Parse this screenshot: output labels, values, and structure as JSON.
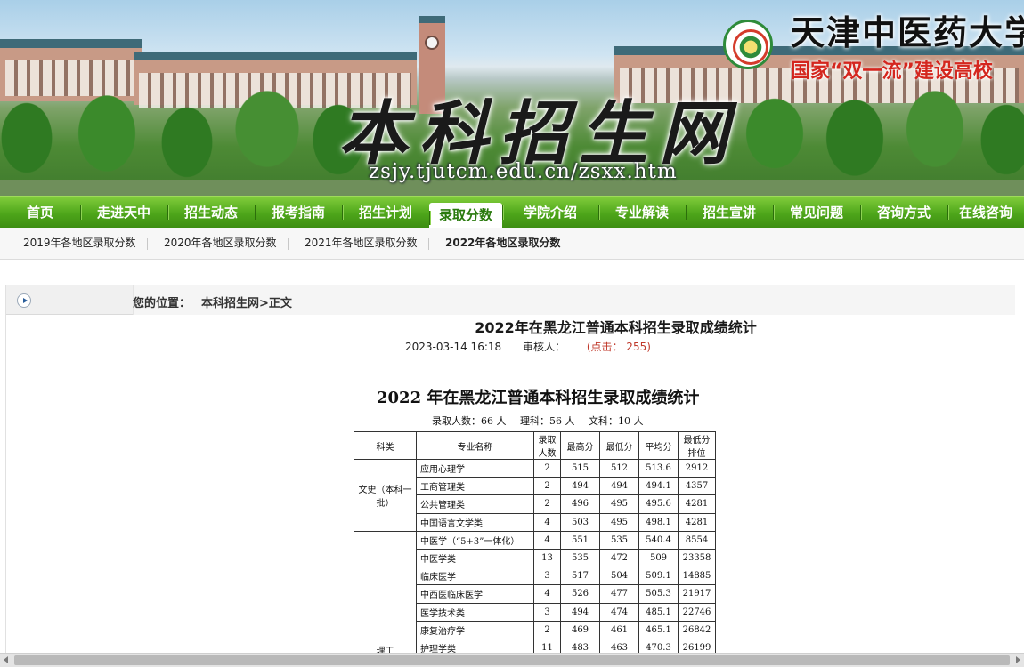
{
  "banner": {
    "title": "本科招生网",
    "url": "zsjy.tjutcm.edu.cn/zsxx.htm",
    "university": "天津中医药大学",
    "slogan": "国家“双一流”建设高校"
  },
  "nav": {
    "items": [
      "首页",
      "走进天中",
      "招生动态",
      "报考指南",
      "招生计划",
      "录取分数",
      "学院介绍",
      "专业解读",
      "招生宣讲",
      "常见问题",
      "咨询方式",
      "在线咨询"
    ],
    "active_index": 5
  },
  "subnav": {
    "items": [
      "2019年各地区录取分数",
      "2020年各地区录取分数",
      "2021年各地区录取分数",
      "2022年各地区录取分数"
    ],
    "active_index": 3
  },
  "breadcrumb": {
    "label": "您的位置：",
    "path": "本科招生网>正文"
  },
  "article": {
    "title": "2022年在黑龙江普通本科招生录取成绩统计",
    "date": "2023-03-14 16:18",
    "reviewer": "审核人：",
    "clicks": "(点击： 255)"
  },
  "doc": {
    "title": "2022 年在黑龙江普通本科招生录取成绩统计",
    "summary": [
      "录取人数：66 人",
      "理科：56 人",
      "文科：10 人"
    ],
    "headers": [
      "科类",
      "专业名称",
      "录取人数",
      "最高分",
      "最低分",
      "平均分",
      "最低分排位"
    ],
    "groups": [
      {
        "category": "文史（本科一批）",
        "rows": [
          [
            "应用心理学",
            "2",
            "515",
            "512",
            "513.6",
            "2912"
          ],
          [
            "工商管理类",
            "2",
            "494",
            "494",
            "494.1",
            "4357"
          ],
          [
            "公共管理类",
            "2",
            "496",
            "495",
            "495.6",
            "4281"
          ],
          [
            "中国语言文学类",
            "4",
            "503",
            "495",
            "498.1",
            "4281"
          ]
        ]
      },
      {
        "category": "理工",
        "rows": [
          [
            "中医学（“5+3”一体化）",
            "4",
            "551",
            "535",
            "540.4",
            "8554"
          ],
          [
            "中医学类",
            "13",
            "535",
            "472",
            "509",
            "23358"
          ],
          [
            "临床医学",
            "3",
            "517",
            "504",
            "509.1",
            "14885"
          ],
          [
            "中西医临床医学",
            "4",
            "526",
            "477",
            "505.3",
            "21917"
          ],
          [
            "医学技术类",
            "3",
            "494",
            "474",
            "485.1",
            "22746"
          ],
          [
            "康复治疗学",
            "2",
            "469",
            "461",
            "465.1",
            "26842"
          ],
          [
            "护理学类",
            "11",
            "483",
            "463",
            "470.3",
            "26199"
          ]
        ]
      }
    ]
  }
}
